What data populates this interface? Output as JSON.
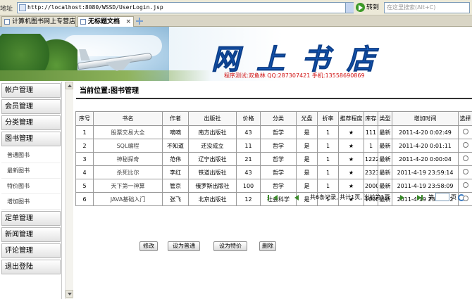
{
  "browser": {
    "address_label": "地址",
    "url": "http://localhost:8080/WSSD/UserLogin.jsp",
    "go_label": "转到",
    "search_placeholder": "在这里搜索(Alt+C)",
    "tabs": [
      {
        "label": "计算机图书网上专营店",
        "active": false
      },
      {
        "label": "无标题文档",
        "active": true
      }
    ]
  },
  "banner": {
    "title": "网上书店",
    "contact": "程序测试:双鱼林  QQ:287307421  手机:13558690869"
  },
  "sidebar": {
    "items": [
      {
        "label": "帐户管理",
        "type": "menu"
      },
      {
        "label": "会员管理",
        "type": "menu"
      },
      {
        "label": "分类管理",
        "type": "menu"
      },
      {
        "label": "图书管理",
        "type": "menu"
      },
      {
        "label": "普通图书",
        "type": "sub"
      },
      {
        "label": "最新图书",
        "type": "sub"
      },
      {
        "label": "特价图书",
        "type": "sub"
      },
      {
        "label": "增加图书",
        "type": "sub"
      },
      {
        "label": "定单管理",
        "type": "menu"
      },
      {
        "label": "新闻管理",
        "type": "menu"
      },
      {
        "label": "评论管理",
        "type": "menu"
      },
      {
        "label": "退出登陆",
        "type": "menu"
      }
    ]
  },
  "main": {
    "breadcrumb": "当前位置:图书管理",
    "table": {
      "headers": [
        "序号",
        "书名",
        "作者",
        "出版社",
        "价格",
        "分类",
        "光盘",
        "折率",
        "推荐程度",
        "库存",
        "类型",
        "增加时间",
        "选择"
      ],
      "rows": [
        [
          "1",
          "股票交易大全",
          "嘀嘀",
          "南方出版社",
          "43",
          "哲学",
          "是",
          "1",
          "★",
          "111",
          "最新",
          "2011-4-20 0:02:49"
        ],
        [
          "2",
          "SQL编程",
          "不知道",
          "还没成立",
          "11",
          "哲学",
          "是",
          "1",
          "★",
          "1",
          "最新",
          "2011-4-20 0:01:11"
        ],
        [
          "3",
          "神秘探奇",
          "范伟",
          "辽宁出版社",
          "21",
          "哲学",
          "是",
          "1",
          "★",
          "1222",
          "最新",
          "2011-4-20 0:00:04"
        ],
        [
          "4",
          "杀死比尔",
          "李红",
          "铁道出版社",
          "43",
          "哲学",
          "是",
          "1",
          "★",
          "23232",
          "最新",
          "2011-4-19 23:59:14"
        ],
        [
          "5",
          "天下第一神算",
          "管京",
          "俄罗斯出版社",
          "100",
          "哲学",
          "是",
          "1",
          "★",
          "2000",
          "最新",
          "2011-4-19 23:58:09"
        ],
        [
          "6",
          "JAVA基础入门",
          "张飞",
          "北京出版社",
          "12",
          "社会科学",
          "是",
          "1",
          "★",
          "1000",
          "最新",
          "2011-4-19 23:57:02"
        ]
      ]
    },
    "pager": {
      "summary": "共6条记录, 共计1页, 当前第1页",
      "goto_prefix": "第",
      "goto_suffix": "页"
    },
    "buttons": {
      "edit": "修改",
      "set_normal": "设为普通",
      "set_special": "设为特价",
      "delete": "删除"
    }
  }
}
